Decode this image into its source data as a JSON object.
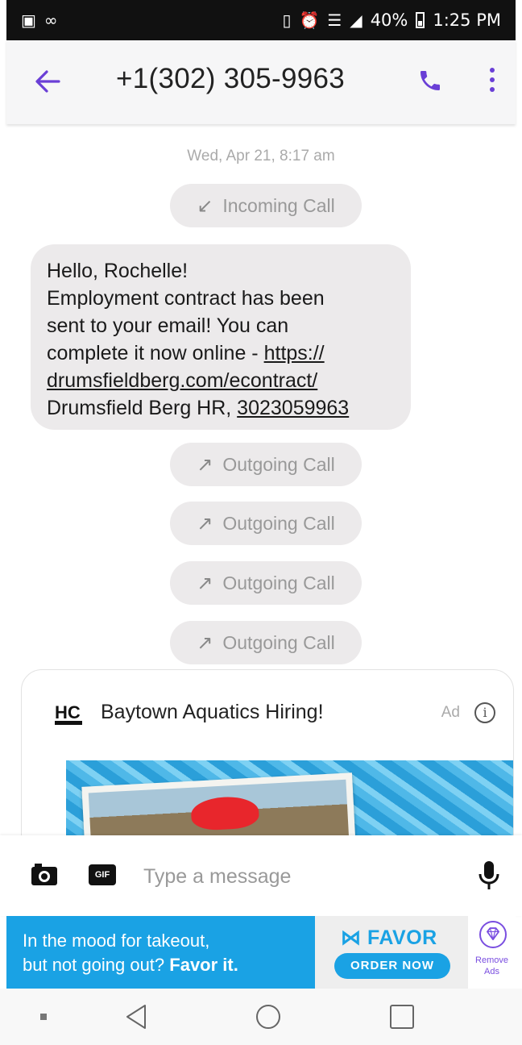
{
  "status_bar": {
    "left_icons": [
      "image-icon",
      "voicemail-icon"
    ],
    "right_icons": [
      "vibrate-icon",
      "alarm-icon",
      "wifi-icon",
      "signal-icon"
    ],
    "battery": "40%",
    "time": "1:25 PM"
  },
  "header": {
    "title": "+1(302) 305-9963",
    "icons": [
      "back-arrow-icon",
      "phone-icon",
      "more-vert-icon"
    ]
  },
  "conversation": {
    "date": "Wed, Apr 21, 8:17 am",
    "incoming_call": {
      "label": "Incoming Call",
      "icon": "arrow-down-left-icon"
    },
    "message": {
      "line1": "Hello, Rochelle!",
      "line2": "Employment contract has been",
      "line3": "sent to your email! You can",
      "line4": "complete it now online - ",
      "link_part1": "https://",
      "link_part2": "drumsfieldberg.com/econtract/",
      "signature": "Drumsfield Berg HR, ",
      "phone_link": "3023059963"
    },
    "outgoing_calls": [
      {
        "label": "Outgoing Call",
        "icon": "arrow-up-right-icon"
      },
      {
        "label": "Outgoing Call",
        "icon": "arrow-up-right-icon"
      },
      {
        "label": "Outgoing Call",
        "icon": "arrow-up-right-icon"
      },
      {
        "label": "Outgoing Call",
        "icon": "arrow-up-right-icon"
      }
    ]
  },
  "ad_card": {
    "logo_text": "HC",
    "title": "Baytown Aquatics Hiring!",
    "label": "Ad",
    "info_icon": "info-icon"
  },
  "composer": {
    "placeholder": "Type a message",
    "gif_label": "GIF",
    "icons": [
      "camera-icon",
      "gif-icon",
      "mic-icon"
    ]
  },
  "banner_ad": {
    "line1": "In the mood for takeout,",
    "line2_plain": "but not going out? ",
    "line2_bold": "Favor it.",
    "brand": "FAVOR",
    "cta": "ORDER NOW",
    "remove_line1": "Remove",
    "remove_line2": "Ads",
    "colors": {
      "brand_blue": "#1aa2e4",
      "accent_purple": "#7a4ee0"
    }
  },
  "nav_bar": {
    "icons": [
      "square-dot-icon",
      "nav-back-icon",
      "nav-home-icon",
      "nav-recents-icon"
    ]
  },
  "colors": {
    "accent": "#6a3fd6",
    "bubble_bg": "#eceaeb"
  }
}
